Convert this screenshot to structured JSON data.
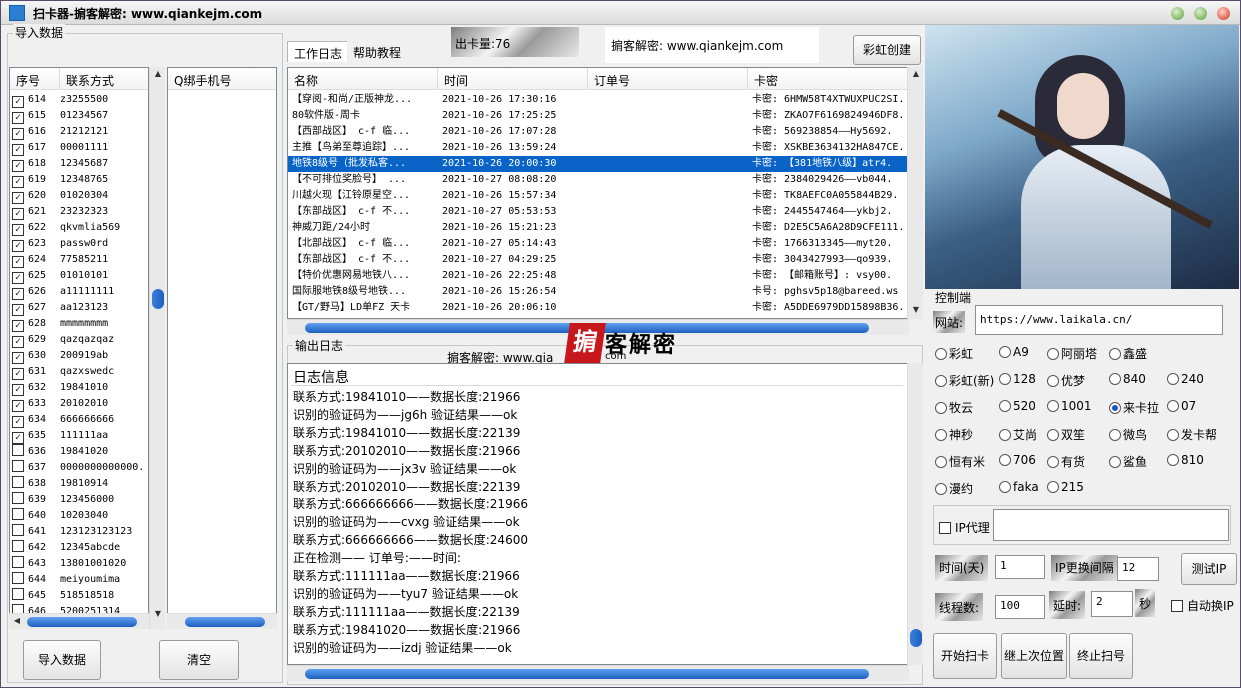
{
  "window": {
    "title": "扫卡器-掮客解密: www.qiankejm.com"
  },
  "import_group": {
    "label": "导入数据",
    "col_seq": "序号",
    "col_contact": "联系方式",
    "col_qq": "Q绑手机号",
    "rows": [
      {
        "n": "614",
        "v": "z3255500",
        "c": true
      },
      {
        "n": "615",
        "v": "01234567",
        "c": true
      },
      {
        "n": "616",
        "v": "21212121",
        "c": true
      },
      {
        "n": "617",
        "v": "00001111",
        "c": true
      },
      {
        "n": "618",
        "v": "12345687",
        "c": true
      },
      {
        "n": "619",
        "v": "12348765",
        "c": true
      },
      {
        "n": "620",
        "v": "01020304",
        "c": true
      },
      {
        "n": "621",
        "v": "23232323",
        "c": true
      },
      {
        "n": "622",
        "v": "qkvmlia569",
        "c": true
      },
      {
        "n": "623",
        "v": "passw0rd",
        "c": true
      },
      {
        "n": "624",
        "v": "77585211",
        "c": true
      },
      {
        "n": "625",
        "v": "01010101",
        "c": true
      },
      {
        "n": "626",
        "v": "a11111111",
        "c": true
      },
      {
        "n": "627",
        "v": "aa123123",
        "c": true
      },
      {
        "n": "628",
        "v": "mmmmmmmm",
        "c": true
      },
      {
        "n": "629",
        "v": "qazqazqaz",
        "c": true
      },
      {
        "n": "630",
        "v": "200919ab",
        "c": true
      },
      {
        "n": "631",
        "v": "qazxswedc",
        "c": true
      },
      {
        "n": "632",
        "v": "19841010",
        "c": true
      },
      {
        "n": "633",
        "v": "20102010",
        "c": true
      },
      {
        "n": "634",
        "v": "666666666",
        "c": true
      },
      {
        "n": "635",
        "v": "111111aa",
        "c": true
      },
      {
        "n": "636",
        "v": "19841020",
        "c": false
      },
      {
        "n": "637",
        "v": "0000000000000.",
        "c": false
      },
      {
        "n": "638",
        "v": "19810914",
        "c": false
      },
      {
        "n": "639",
        "v": "123456000",
        "c": false
      },
      {
        "n": "640",
        "v": "10203040",
        "c": false
      },
      {
        "n": "641",
        "v": "123123123123",
        "c": false
      },
      {
        "n": "642",
        "v": "12345abcde",
        "c": false
      },
      {
        "n": "643",
        "v": "13801001020",
        "c": false
      },
      {
        "n": "644",
        "v": "meiyoumima",
        "c": false
      },
      {
        "n": "645",
        "v": "518518518",
        "c": false
      },
      {
        "n": "646",
        "v": "5200251314",
        "c": false
      }
    ],
    "import_btn": "导入数据",
    "clear_btn": "清空"
  },
  "tabs": {
    "work": "工作日志",
    "help": "帮助教程"
  },
  "header": {
    "count_label": "出卡量:",
    "count": "76",
    "site": "掮客解密: www.qiankejm.com",
    "create_btn": "彩虹创建"
  },
  "cards": {
    "col_name": "名称",
    "col_time": "时间",
    "col_order": "订单号",
    "col_key": "卡密",
    "rows": [
      {
        "name": "【穿阅-和尚/正版神龙...",
        "time": "2021-10-26 17:30:16",
        "key": "卡密: 6HMW58T4XTWUXPUC2SI."
      },
      {
        "name": "80软件版-周卡",
        "time": "2021-10-26 17:25:25",
        "key": "卡密: ZKAO7F6169824946DF8."
      },
      {
        "name": "【西部战区】 c-f 临...",
        "time": "2021-10-26 17:07:28",
        "key": "卡密: 569238854——Hy5692."
      },
      {
        "name": "主推【鸟弟至尊追踪】...",
        "time": "2021-10-26 13:59:24",
        "key": "卡密: XSKBE3634132HA847CE."
      },
      {
        "name": "地铁8级号（批发私客...",
        "time": "2021-10-26 20:00:30",
        "key": "卡密: 【381地铁八级】atr4."
      },
      {
        "name": "【不可排位奖脸号】 ...",
        "time": "2021-10-27 08:08:20",
        "key": "卡密: 2384029426——vb044."
      },
      {
        "name": "川越火现【江铃原星空...",
        "time": "2021-10-26 15:57:34",
        "key": "卡密: TK8AEFC0A055844B29."
      },
      {
        "name": "【东部战区】 c-f 不...",
        "time": "2021-10-27 05:53:53",
        "key": "卡密: 2445547464——ykbj2."
      },
      {
        "name": "神威刀距/24小时",
        "time": "2021-10-26 15:21:23",
        "key": "卡密: D2E5C5A6A28D9CFE111."
      },
      {
        "name": "【北部战区】 c-f 临...",
        "time": "2021-10-27 05:14:43",
        "key": "卡密: 1766313345——myt20."
      },
      {
        "name": "【东部战区】 c-f 不...",
        "time": "2021-10-27 04:29:25",
        "key": "卡密: 3043427993——qo939."
      },
      {
        "name": "【特价优惠网易地铁八...",
        "time": "2021-10-26 22:25:48",
        "key": "卡密: 【邮箱账号】: vsy00."
      },
      {
        "name": "国际服地铁8级号地铁...",
        "time": "2021-10-26 15:26:54",
        "key": "卡号: pghsv5p18@bareed.ws"
      },
      {
        "name": "【GT/野马】LD单FZ 天卡",
        "time": "2021-10-26 20:06:10",
        "key": "卡密: A5DDE6979DD15898B36."
      }
    ]
  },
  "output": {
    "label": "输出日志",
    "site": "掮客解密: www.qia",
    "log_header": "日志信息",
    "lines": [
      "联系方式:19841010——数据长度:21966",
      "识别的验证码为——jg6h   验证结果——ok",
      "联系方式:19841010——数据长度:22139",
      "联系方式:20102010——数据长度:21966",
      "识别的验证码为——jx3v   验证结果——ok",
      "联系方式:20102010——数据长度:22139",
      "联系方式:666666666——数据长度:21966",
      "识别的验证码为——cvxg   验证结果——ok",
      "联系方式:666666666——数据长度:24600",
      "正在检测—— 订单号:——时间:",
      "联系方式:111111aa——数据长度:21966",
      "识别的验证码为——tyu7   验证结果——ok",
      "联系方式:111111aa——数据长度:22139",
      "联系方式:19841020——数据长度:21966",
      "识别的验证码为——izdj   验证结果——ok"
    ]
  },
  "watermark": {
    "text": "客解密",
    "sub": "com"
  },
  "control": {
    "label": "控制端",
    "url_label": "网站:",
    "url": "https://www.laikala.cn/",
    "options": [
      "彩虹",
      "A9",
      "阿丽塔",
      "鑫盛",
      "彩虹(新)",
      "128",
      "优梦",
      "840",
      "240",
      "牧云",
      "520",
      "1001",
      "来卡拉",
      "07",
      "神秒",
      "艾尚",
      "双笙",
      "微鸟",
      "发卡帮",
      "恒有米",
      "706",
      "有货",
      "鲨鱼",
      "810",
      "漫约",
      "faka",
      "215"
    ],
    "selected": "来卡拉",
    "proxy_label": "IP代理",
    "days_label": "时间(天)",
    "days": "1",
    "interval_label": "IP更换间隔",
    "interval": "12",
    "test_ip_btn": "测试IP",
    "threads_label": "线程数:",
    "threads": "100",
    "delay_label": "延时:",
    "delay": "2",
    "sec": "秒",
    "auto_ip": "自动换IP",
    "start_btn": "开始扫卡",
    "continue_btn": "继上次位置",
    "stop_btn": "终止扫号"
  },
  "colors": {
    "selection": "#0a64c8",
    "scroll": "#1d5fc0"
  }
}
